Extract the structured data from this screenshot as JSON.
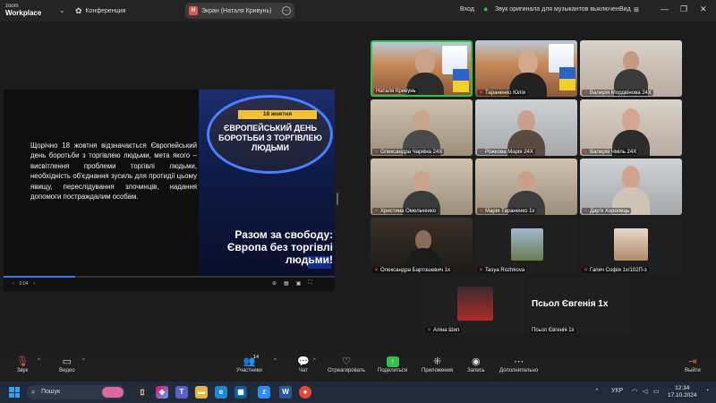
{
  "titlebar": {
    "app_name": "zoom",
    "app_subname": "Workplace",
    "conference_label": "Конференция",
    "screen_pill_initial": "Н",
    "screen_pill_label": "Экран (Наталя Кривунь)",
    "login_label": "Вход",
    "audio_status": "Звук оригинала для музыкантов выключен",
    "view_label": "Вид"
  },
  "slide": {
    "body": "Щорічно 18 жовтня відзначається Європейський день боротьби з торгівлею людьми, мета якого – висвітлення проблеми торгівлі людьми, необхідність об'єднання зусиль для протидії цьому явищу, переслідування злочинців, надання допомоги постраждалим особам.",
    "date_badge": "18 жовтня",
    "banner_title": "Європейський день боротьби з торгівлею людьми",
    "slogan": "Разом за свободу: Європа без торгівлі людьми!",
    "slide_counter": "0:04"
  },
  "participants": [
    {
      "name": "Наталя Кривунь",
      "muted": false,
      "active": true
    },
    {
      "name": "Тараненко Юлія",
      "muted": true
    },
    {
      "name": "Валерія Мордвінова 24Х",
      "muted": true
    },
    {
      "name": "Олександра Чаркіна 24Х",
      "muted": true
    },
    {
      "name": "Рожкова Марія 24Х",
      "muted": true
    },
    {
      "name": "Валерія Чміль 24Х",
      "muted": true
    },
    {
      "name": "Христина Омельченко",
      "muted": true
    },
    {
      "name": "Марія Тараненко 1х",
      "muted": true
    },
    {
      "name": "Дар'я Хоролець",
      "muted": true
    },
    {
      "name": "Олександра Бартошевич 1х",
      "muted": true
    },
    {
      "name": "Tasya Rozhkova",
      "muted": true
    },
    {
      "name": "Гапич Софія 1х/102П-з",
      "muted": true
    },
    {
      "name": "Аліна Шип",
      "muted": true
    },
    {
      "name": "Псьол Євгенія 1х",
      "muted": false,
      "big_label": "Псьол Євгенія 1х"
    }
  ],
  "toolbar": {
    "audio": "Звук",
    "video": "Видео",
    "participants": "Участники",
    "participants_count": "14",
    "chat": "Чат",
    "react": "Отреагировать",
    "share": "Поделиться",
    "apps": "Приложения",
    "record": "Запись",
    "more": "Дополнительно",
    "leave": "Выйти"
  },
  "taskbar": {
    "search_placeholder": "Пошук",
    "language": "УКР",
    "time": "12:34",
    "date": "17.10.2024"
  }
}
